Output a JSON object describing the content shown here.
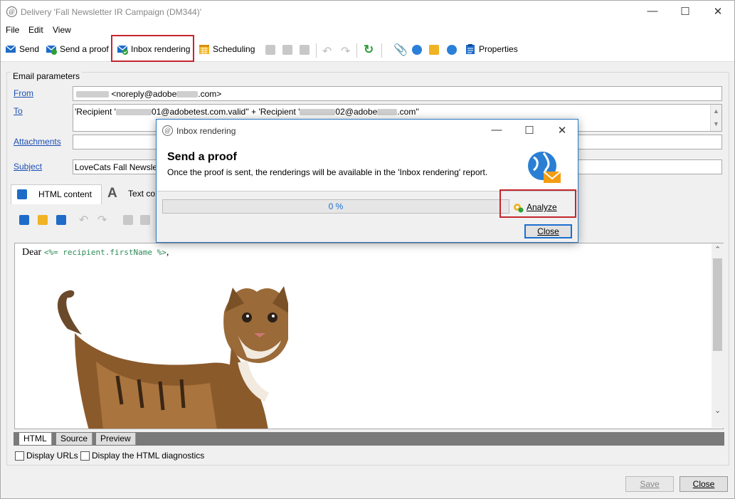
{
  "window": {
    "title": "Delivery 'Fall Newsletter IR Campaign (DM344)'"
  },
  "menu": [
    "File",
    "Edit",
    "View"
  ],
  "toolbar": {
    "send": "Send",
    "send_proof": "Send a proof",
    "inbox_rendering": "Inbox rendering",
    "scheduling": "Scheduling",
    "properties": "Properties"
  },
  "params": {
    "group_label": "Email parameters",
    "from_label": "From",
    "from_value": "<noreply@adobe",
    ".com>": ".com>",
    "from_suffix": ".com>",
    "to_label": "To",
    "to_part1": "'Recipient '",
    "to_part2": "01@adobetest.com.valid'' + 'Recipient '",
    "to_part3": "02@adobe",
    "to_part4": ".com''",
    "attachments_label": "Attachments",
    "subject_label": "Subject",
    "subject_value": "LoveCats Fall Newslet"
  },
  "content_tabs": {
    "html": "HTML content",
    "text": "Text co"
  },
  "editor": {
    "dear": "Dear ",
    "code": "<%= recipient.firstName %>",
    "comma": ","
  },
  "view_tabs": [
    "HTML",
    "Source",
    "Preview"
  ],
  "options": {
    "display_urls": "Display URLs",
    "html_diag": "Display the HTML diagnostics"
  },
  "buttons": {
    "save": "Save",
    "close": "Close"
  },
  "dialog": {
    "title": "Inbox rendering",
    "heading": "Send a proof",
    "description": "Once the proof is sent, the renderings will be available in the 'Inbox rendering' report.",
    "progress_text": "0 %",
    "progress": 0,
    "analyze": "Analyze",
    "close": "Close"
  },
  "colors": {
    "accent": "#1b4fb5",
    "highlight": "#c4262e",
    "progress_text": "#1c6fd1"
  }
}
